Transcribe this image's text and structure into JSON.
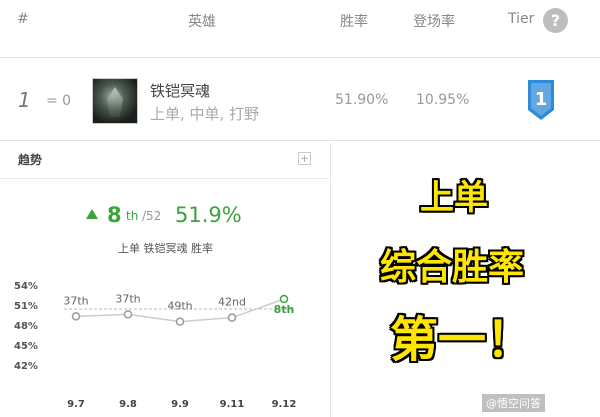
{
  "header": {
    "hash": "#",
    "hero": "英雄",
    "win_rate": "胜率",
    "pick_rate": "登场率",
    "tier": "Tier",
    "help": "?"
  },
  "row": {
    "rank": "1",
    "change": "= 0",
    "hero_name": "铁铠冥魂",
    "positions": "上单, 中单, 打野",
    "win_rate": "51.90%",
    "pick_rate": "10.95%",
    "tier": "1"
  },
  "trend": {
    "title": "趋势",
    "plus": "+",
    "rank": "8",
    "rank_suffix": "th",
    "rank_total": "/52",
    "win_rate": "51.9%",
    "subtitle": "上单 铁铠冥魂 胜率"
  },
  "chart_data": {
    "type": "line",
    "y_ticks": [
      "54%",
      "51%",
      "48%",
      "45%",
      "42%"
    ],
    "ylim": [
      42,
      54
    ],
    "categories": [
      "9.7",
      "9.8",
      "9.9",
      "9.11",
      "9.12"
    ],
    "values": [
      49.3,
      49.6,
      48.5,
      49.1,
      51.9
    ],
    "rank_labels": [
      "37th",
      "37th",
      "49th",
      "42nd",
      "8th"
    ],
    "colors": {
      "line": "#cccccc",
      "point": "#999999",
      "highlight": "#3aa33a"
    }
  },
  "overlay": {
    "line1": "上单",
    "line2": "综合胜率",
    "line3": "第一！"
  },
  "watermark": "@悟空问答",
  "colors": {
    "accent": "#3aa33a",
    "overlay": "#ffe600",
    "badge": "#2f8ad8"
  }
}
